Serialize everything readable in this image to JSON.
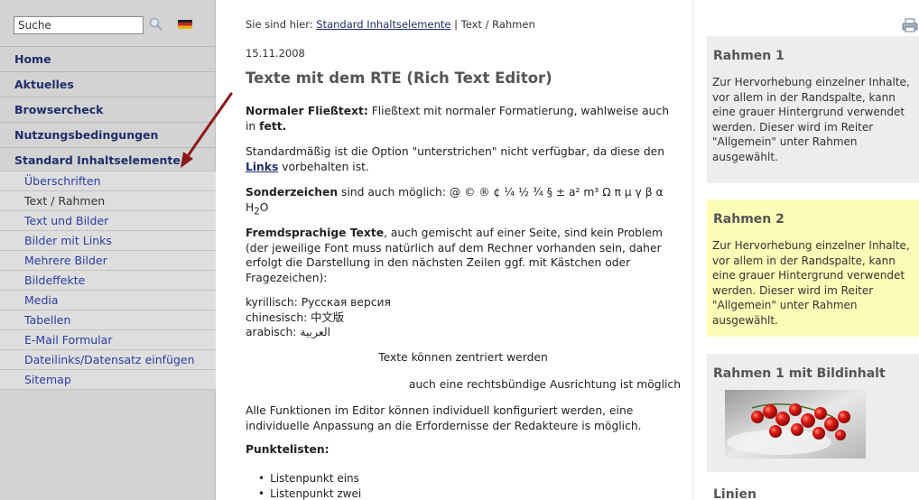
{
  "search": {
    "value": "Suche"
  },
  "nav": {
    "main": [
      {
        "label": "Home"
      },
      {
        "label": "Aktuelles"
      },
      {
        "label": "Browsercheck"
      },
      {
        "label": "Nutzungsbedingungen"
      },
      {
        "label": "Standard Inhaltselemente"
      }
    ],
    "sub": [
      {
        "label": "Überschriften"
      },
      {
        "label": "Text / Rahmen"
      },
      {
        "label": "Text und Bilder"
      },
      {
        "label": "Bilder mit Links"
      },
      {
        "label": "Mehrere Bilder"
      },
      {
        "label": "Bildeffekte"
      },
      {
        "label": "Media"
      },
      {
        "label": "Tabellen"
      },
      {
        "label": "E-Mail Formular"
      },
      {
        "label": "Dateilinks/Datensatz einfügen"
      },
      {
        "label": "Sitemap"
      }
    ]
  },
  "breadcrumb": {
    "prefix": "Sie sind hier:",
    "link": "Standard Inhaltselemente",
    "separator": "|",
    "current": "Text / Rahmen"
  },
  "content": {
    "date": "15.11.2008",
    "title": "Texte mit dem RTE (Rich Text Editor)",
    "p1_bold": "Normaler Fließtext:",
    "p1_text": " Fließtext mit normaler Formatierung, wahlweise auch in ",
    "p1_bold2": "fett.",
    "p2_text": "Standardmäßig ist die Option \"unterstrichen\" nicht verfügbar, da diese den ",
    "p2_link": "Links",
    "p2_text2": " vorbehalten ist.",
    "p3_bold": "Sonderzeichen",
    "p3_text": " sind auch möglich: @ © ® ¢ ¼ ½ ¾ § ± a² m³ Ω π µ γ β α H",
    "p3_sub": "2",
    "p3_end": "O",
    "p4_bold": "Fremdsprachige Texte",
    "p4_text": ", auch gemischt auf einer Seite, sind kein Problem (der jeweilige Font muss natürlich auf dem Rechner vorhanden sein, daher erfolgt die Darstellung in den nächsten Zeilen ggf. mit Kästchen oder Fragezeichen):",
    "lang1": "kyrillisch: Русская версия",
    "lang2": "chinesisch: 中文版",
    "lang3": "arabisch: العربية",
    "centered": "Texte können zentriert werden",
    "right": "auch eine rechtsbündige Ausrichtung ist möglich",
    "p5": "Alle Funktionen im Editor können individuell konfiguriert werden, eine individuelle Anpassung an die Erfordernisse der Redakteure is möglich.",
    "list_heading": "Punktelisten:",
    "list_items": [
      "Listenpunkt eins",
      "Listenpunkt zwei"
    ]
  },
  "sidebar_right": {
    "box1": {
      "title": "Rahmen 1",
      "text": "Zur Hervorhebung einzelner Inhalte, vor allem in der Randspalte, kann eine grauer Hintergrund verwendet werden. Dieser wird im Reiter \"Allgemein\" unter Rahmen ausgewählt."
    },
    "box2": {
      "title": "Rahmen 2",
      "text": "Zur Hervorhebung einzelner Inhalte, vor allem in der Randspalte, kann eine grauer Hintergrund verwendet werden. Dieser wird im Reiter \"Allgemein\" unter Rahmen ausgewählt."
    },
    "box3": {
      "title": "Rahmen 1 mit Bildinhalt"
    },
    "linien": "Linien"
  },
  "colors": {
    "nav_link": "#1f2e6a",
    "sub_link": "#2a3da0",
    "sidebar_bg": "#d3d3d3",
    "box_gray": "#ededed",
    "box_yellow": "#fcfcb6",
    "arrow": "#8b1a1a"
  },
  "icons": {
    "search": "magnifier-icon",
    "flag": "german-flag-icon",
    "print": "printer-icon"
  }
}
